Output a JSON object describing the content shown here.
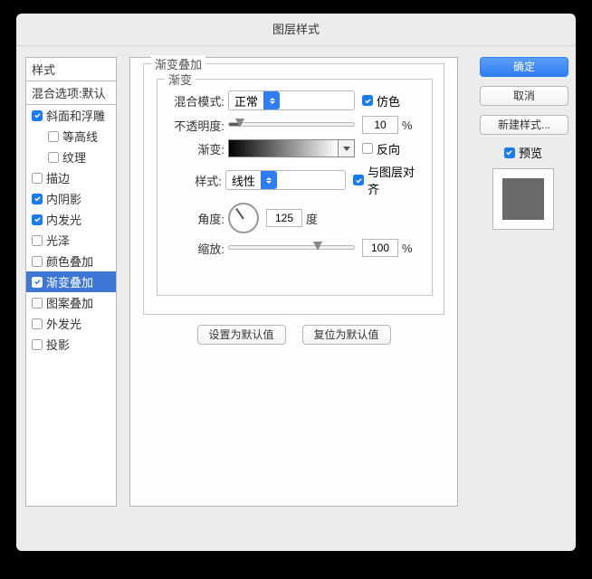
{
  "title": "图层样式",
  "sidebar": {
    "header1": "样式",
    "header2": "混合选项:默认",
    "items": [
      {
        "label": "斜面和浮雕",
        "checked": true,
        "sub": false,
        "selected": false
      },
      {
        "label": "等高线",
        "checked": false,
        "sub": true,
        "selected": false
      },
      {
        "label": "纹理",
        "checked": false,
        "sub": true,
        "selected": false
      },
      {
        "label": "描边",
        "checked": false,
        "sub": false,
        "selected": false
      },
      {
        "label": "内阴影",
        "checked": true,
        "sub": false,
        "selected": false
      },
      {
        "label": "内发光",
        "checked": true,
        "sub": false,
        "selected": false
      },
      {
        "label": "光泽",
        "checked": false,
        "sub": false,
        "selected": false
      },
      {
        "label": "颜色叠加",
        "checked": false,
        "sub": false,
        "selected": false
      },
      {
        "label": "渐变叠加",
        "checked": true,
        "sub": false,
        "selected": true
      },
      {
        "label": "图案叠加",
        "checked": false,
        "sub": false,
        "selected": false
      },
      {
        "label": "外发光",
        "checked": false,
        "sub": false,
        "selected": false
      },
      {
        "label": "投影",
        "checked": false,
        "sub": false,
        "selected": false
      }
    ]
  },
  "panel": {
    "outer_title": "渐变叠加",
    "inner_title": "渐变",
    "blend_label": "混合模式:",
    "blend_value": "正常",
    "dither_label": "仿色",
    "dither_checked": true,
    "opacity_label": "不透明度:",
    "opacity_value": "10",
    "opacity_unit": "%",
    "gradient_label": "渐变:",
    "reverse_label": "反向",
    "reverse_checked": false,
    "style_label": "样式:",
    "style_value": "线性",
    "align_label": "与图层对齐",
    "align_checked": true,
    "angle_label": "角度:",
    "angle_value": "125",
    "angle_unit": "度",
    "scale_label": "缩放:",
    "scale_value": "100",
    "scale_unit": "%",
    "btn_default": "设置为默认值",
    "btn_reset": "复位为默认值"
  },
  "right": {
    "ok": "确定",
    "cancel": "取消",
    "newstyle": "新建样式...",
    "preview_label": "预览",
    "preview_checked": true
  }
}
